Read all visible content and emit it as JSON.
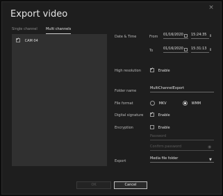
{
  "dialog": {
    "title": "Export video",
    "close_label": "×"
  },
  "tabs": [
    {
      "label": "Single channel",
      "active": false
    },
    {
      "label": "Multi channels",
      "active": true
    }
  ],
  "channels": [
    {
      "label": "CAM 04",
      "checked": true
    }
  ],
  "date_time": {
    "label": "Date & Time",
    "from_label": "From",
    "from_date": "01/16/2020",
    "from_time": "15:24:35",
    "to_label": "To",
    "to_date": "01/16/2020",
    "to_time": "15:31:13",
    "spin": "⇕"
  },
  "high_resolution": {
    "label": "High resolution",
    "option_label": "Enable",
    "checked": true
  },
  "folder": {
    "label": "Folder name",
    "value": "MultiChannelExport"
  },
  "file_format": {
    "label": "File format",
    "options": [
      {
        "label": "MKV",
        "selected": false
      },
      {
        "label": "WMM",
        "selected": true
      }
    ]
  },
  "digital_signature": {
    "label": "Digital signature",
    "option_label": "Enable",
    "checked": true
  },
  "encryption": {
    "label": "Encryption",
    "option_label": "Enable",
    "checked": false,
    "password_placeholder": "Password",
    "confirm_placeholder": "Confirm password"
  },
  "export": {
    "label": "Export",
    "value": "Media file folder",
    "arrow": "▼"
  },
  "buttons": {
    "ok": "OK",
    "cancel": "Cancel"
  }
}
